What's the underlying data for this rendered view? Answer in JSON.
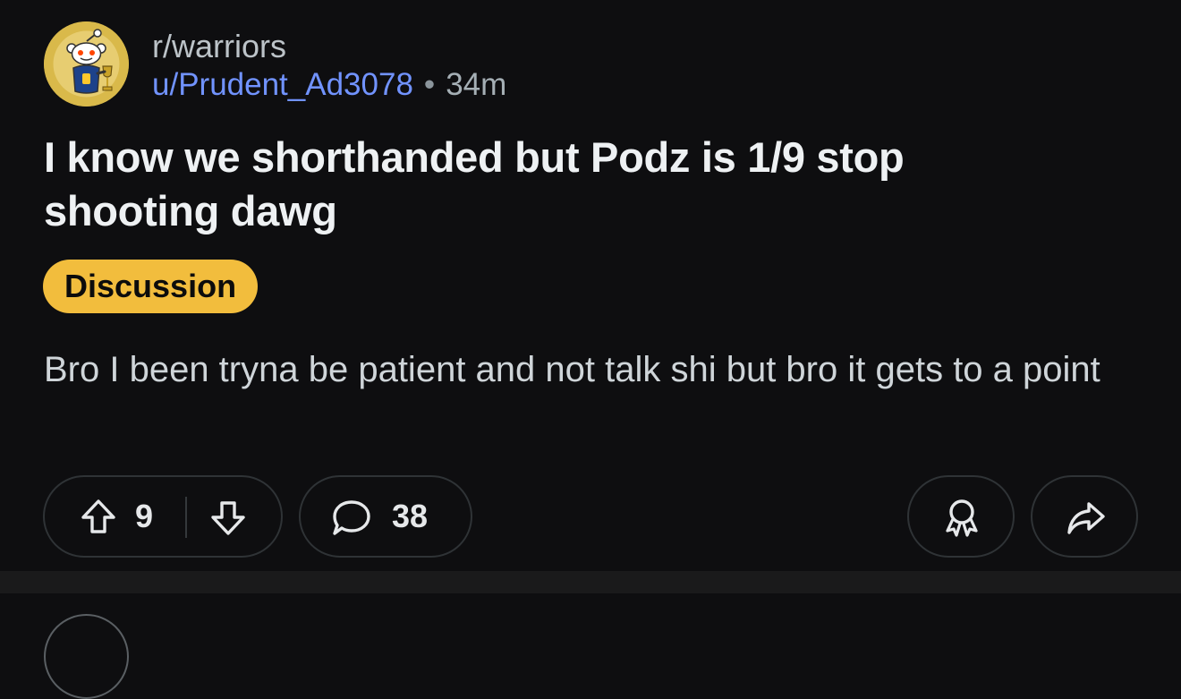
{
  "post": {
    "subreddit": "r/warriors",
    "author": "u/Prudent_Ad3078",
    "separator_dot": "•",
    "age": "34m",
    "title": "I know we shorthanded but Podz is 1/9 stop shooting dawg",
    "flair": "Discussion",
    "body": "Bro I been tryna be patient and not talk shi but bro it gets to a point",
    "avatar_icon": "subreddit-warriors-avatar"
  },
  "actions": {
    "vote_count": "9",
    "comment_count": "38",
    "upvote_icon": "arrow-up-icon",
    "downvote_icon": "arrow-down-icon",
    "comment_icon": "speech-bubble-icon",
    "award_icon": "award-ribbon-icon",
    "share_icon": "share-arrow-icon"
  },
  "colors": {
    "background": "#0e0e10",
    "username": "#7193ff",
    "flair_bg": "#f2bd3d",
    "pill_border": "#2f3336"
  }
}
